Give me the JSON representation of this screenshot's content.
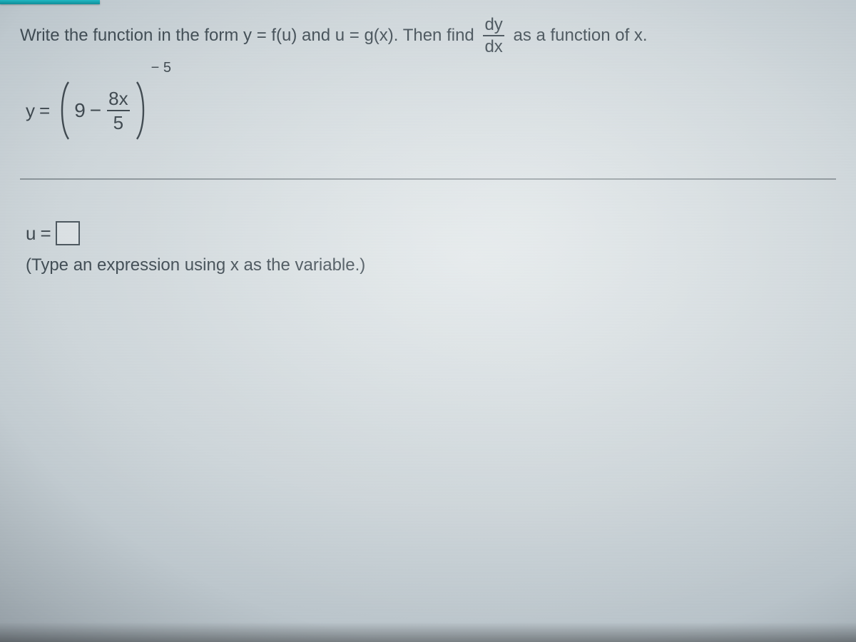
{
  "prompt": {
    "part1": "Write the function in the form y = f(u) and u = g(x). Then find ",
    "frac_num": "dy",
    "frac_den": "dx",
    "part2": " as a function of x."
  },
  "equation": {
    "lhs_var": "y",
    "equals": "=",
    "inner_a": "9",
    "inner_minus": "−",
    "inner_frac_num": "8x",
    "inner_frac_den": "5",
    "exponent": "− 5"
  },
  "answer": {
    "u_label": "u",
    "u_equals": "=",
    "u_value": "",
    "hint": "(Type an expression using x as the variable.)"
  }
}
